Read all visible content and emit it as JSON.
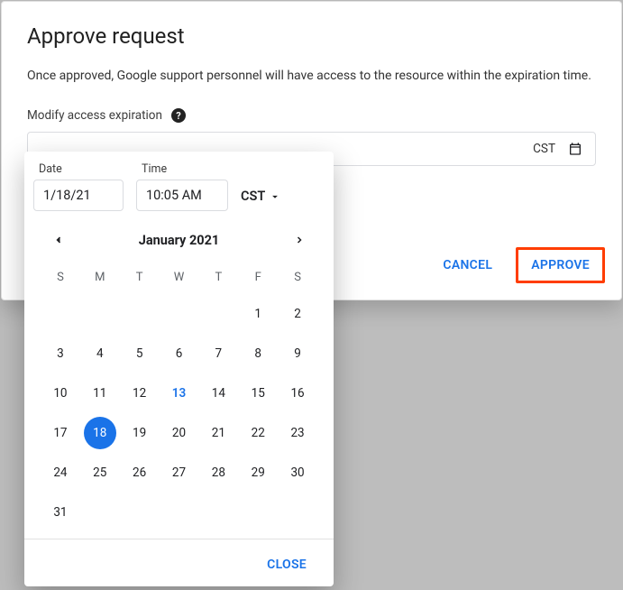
{
  "dialog": {
    "title": "Approve request",
    "description": "Once approved, Google support personnel will have access to the resource within the expiration time.",
    "modify_label": "Modify access expiration",
    "datetime_display": {
      "tz": "CST"
    },
    "actions": {
      "cancel": "CANCEL",
      "approve": "APPROVE"
    }
  },
  "picker": {
    "date_label": "Date",
    "date_value": "1/18/21",
    "time_label": "Time",
    "time_value": "10:05 AM",
    "tz": "CST",
    "month": "January 2021",
    "dow": [
      "S",
      "M",
      "T",
      "W",
      "T",
      "F",
      "S"
    ],
    "leading_blanks": 5,
    "days": 31,
    "today": 13,
    "selected": 18,
    "close": "CLOSE"
  }
}
